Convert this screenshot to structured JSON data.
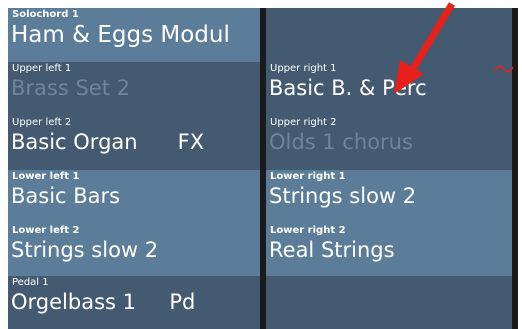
{
  "slots": {
    "solochord": {
      "label": "Solochord 1",
      "value": "Ham & Eggs Modul"
    },
    "upper_left_1": {
      "label": "Upper left 1",
      "value": "Brass Set 2"
    },
    "upper_left_2": {
      "label": "Upper left 2",
      "value": "Basic Organ      FX"
    },
    "lower_left_1": {
      "label": "Lower left 1",
      "value": "Basic Bars"
    },
    "lower_left_2": {
      "label": "Lower left 2",
      "value": "Strings slow 2"
    },
    "pedal_1": {
      "label": "Pedal 1",
      "value": "Orgelbass 1     Pd"
    },
    "upper_right_1": {
      "label": "Upper right 1",
      "value": "Basic B. & Perc"
    },
    "upper_right_2": {
      "label": "Upper right 2",
      "value": "Olds 1 chorus"
    },
    "lower_right_1": {
      "label": "Lower right 1",
      "value": "Strings slow 2"
    },
    "lower_right_2": {
      "label": "Lower right 2",
      "value": "Real Strings"
    }
  },
  "colors": {
    "cell_light": "#5b7d99",
    "cell_dark": "#435a70",
    "text_active": "#ffffff",
    "text_muted": "#6f8498",
    "annotation_arrow": "#e8201a"
  },
  "annotations": {
    "arrow_icon": "red-arrow-pointing-to-upper-right-1",
    "tilde_icon": "red-tilde-indicator"
  }
}
